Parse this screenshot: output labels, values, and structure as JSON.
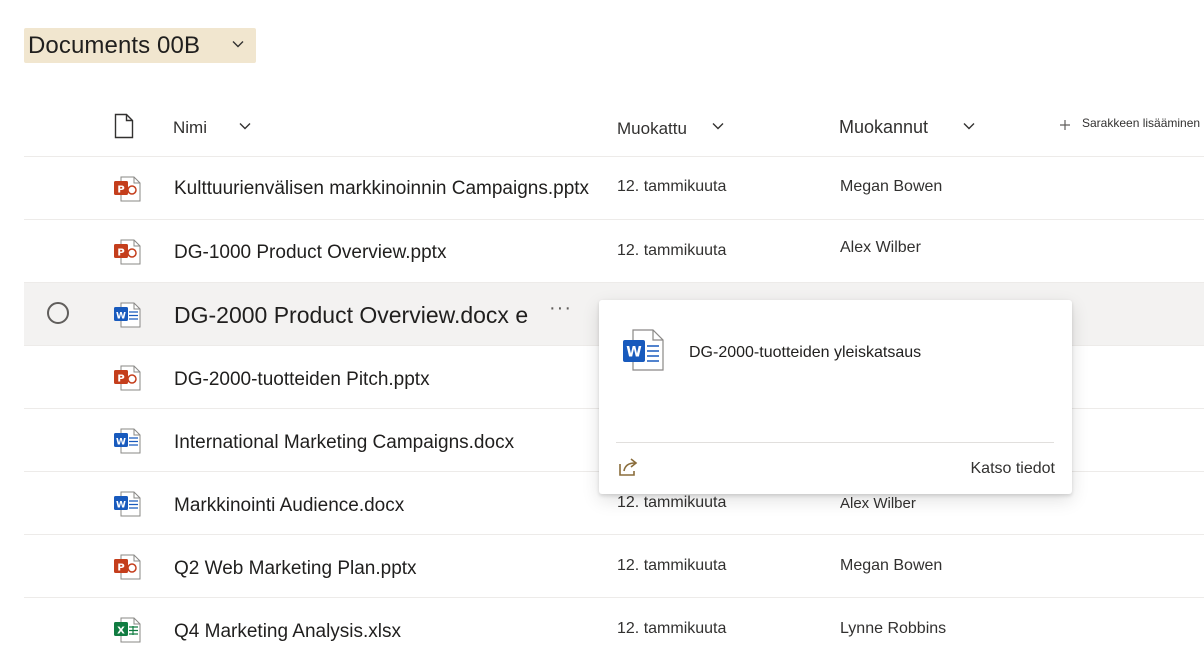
{
  "library": {
    "title": "Documents 00B"
  },
  "columns": {
    "name": "Nimi",
    "modified": "Muokattu",
    "modified_by": "Muokannut",
    "add_column": "Sarakkeen lisääminen"
  },
  "files": [
    {
      "name": "Kulttuurienvälisen markkinoinnin Campaigns.pptx",
      "type": "pptx",
      "modified": "12. tammikuuta",
      "modified_by": "Megan Bowen"
    },
    {
      "name": "DG-1000 Product Overview.pptx",
      "type": "pptx",
      "modified": "12. tammikuuta",
      "modified_by": "Alex Wilber"
    },
    {
      "name": "DG-2000 Product Overview.docx e",
      "type": "docx",
      "modified": "",
      "modified_by": "",
      "more_label": "···"
    },
    {
      "name": "DG-2000-tuotteiden Pitch.pptx",
      "type": "pptx",
      "modified": "",
      "modified_by": ""
    },
    {
      "name": "International Marketing Campaigns.docx",
      "type": "docx",
      "modified": "",
      "modified_by": ""
    },
    {
      "name": "Markkinointi Audience.docx",
      "type": "docx",
      "modified": "12. tammikuuta",
      "modified_by": "Alex Wilber"
    },
    {
      "name": "Q2 Web Marketing Plan.pptx",
      "type": "pptx",
      "modified": "12. tammikuuta",
      "modified_by": "Megan Bowen"
    },
    {
      "name": "Q4 Marketing Analysis.xlsx",
      "type": "xlsx",
      "modified": "12. tammikuuta",
      "modified_by": "Lynne Robbins"
    }
  ],
  "hover_card": {
    "title": "DG-2000-tuotteiden yleiskatsaus",
    "details_link": "Katso tiedot",
    "share_icon": "share-icon"
  },
  "colors": {
    "powerpoint": "#c43e1c",
    "word": "#185abd",
    "excel": "#107c41",
    "title_highlight": "#f1e6cf",
    "share_icon": "#8a6d3b"
  }
}
